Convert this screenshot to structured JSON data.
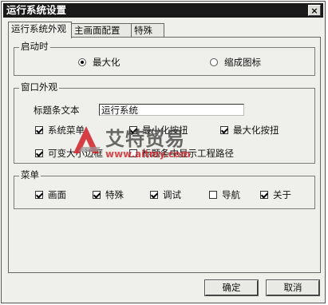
{
  "window": {
    "title": "运行系统设置",
    "close_glyph": "×"
  },
  "tabs": [
    {
      "label": "运行系统外观",
      "active": true
    },
    {
      "label": "主画面配置",
      "active": false
    },
    {
      "label": "特殊",
      "active": false
    }
  ],
  "startup": {
    "legend": "启动时",
    "options": [
      {
        "label": "最大化",
        "selected": true
      },
      {
        "label": "缩成图标",
        "selected": false
      }
    ]
  },
  "appearance": {
    "legend": "窗口外观",
    "title_text_label": "标题条文本",
    "title_text_value": "运行系统",
    "checkboxes": [
      {
        "label": "系统菜单",
        "checked": true
      },
      {
        "label": "最小化按扭",
        "checked": true
      },
      {
        "label": "最大化按扭",
        "checked": true
      },
      {
        "label": "可变大小边框",
        "checked": true
      },
      {
        "label": "标题条中显示工程路径",
        "checked": false
      }
    ]
  },
  "menu": {
    "legend": "菜单",
    "items": [
      {
        "label": "画面",
        "checked": true
      },
      {
        "label": "特殊",
        "checked": true
      },
      {
        "label": "调试",
        "checked": true
      },
      {
        "label": "导航",
        "checked": false
      },
      {
        "label": "关于",
        "checked": true
      }
    ]
  },
  "buttons": {
    "ok": "确定",
    "cancel": "取消"
  },
  "watermark": {
    "brand": "艾特贸易",
    "url": "www.aitmy.com",
    "accent": "#d21f26"
  }
}
